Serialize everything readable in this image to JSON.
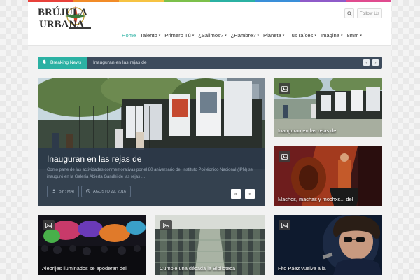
{
  "site": {
    "logo_alt": "Brújula Urbana",
    "logo_line1": "BRÚJULA",
    "logo_line2": "URBANA",
    "follow_label": "Follow Us"
  },
  "nav": {
    "items": [
      {
        "label": "Home",
        "active": true,
        "dropdown": false
      },
      {
        "label": "Talento",
        "active": false,
        "dropdown": true
      },
      {
        "label": "Primero Tú",
        "active": false,
        "dropdown": true
      },
      {
        "label": "¿Salimos?",
        "active": false,
        "dropdown": true
      },
      {
        "label": "¿Hambre?",
        "active": false,
        "dropdown": true
      },
      {
        "label": "Planeta",
        "active": false,
        "dropdown": true
      },
      {
        "label": "Tus raíces",
        "active": false,
        "dropdown": true
      },
      {
        "label": "Imagina",
        "active": false,
        "dropdown": true
      },
      {
        "label": "8mm",
        "active": false,
        "dropdown": true
      }
    ]
  },
  "ticker": {
    "label": "Breaking News",
    "text": "Inauguran en las rejas de"
  },
  "featured": {
    "title": "Inauguran en las rejas de",
    "excerpt": "Como parte de las actividades conmemorativas por el 80 aniversario del Instituto Politécnico Nacional (IPN) se inauguró en la Galería Abierta Gandhi de las rejas …",
    "author": "BY : MAI",
    "date": "AGOSTO 22, 2016",
    "prev": "«",
    "next": "»"
  },
  "side_cards": [
    {
      "caption": "Inauguran en las rejas de"
    },
    {
      "caption": "Machos, machas y mochxs... del"
    }
  ],
  "bottom_cards": [
    {
      "caption": "Alebrijes iluminados se apoderan del"
    },
    {
      "caption": "Cumple una década la Biblioteca"
    },
    {
      "caption": "Fito Páez vuelve a la"
    }
  ],
  "colors": {
    "accent": "#2bb1a3",
    "ticker_bg": "#3d4b5c",
    "top_stripe": [
      "#e8413b",
      "#f28c28",
      "#f6c343",
      "#7cc04b",
      "#2bb1a3",
      "#3a8fd9",
      "#8e5bc9",
      "#e04b8f"
    ]
  },
  "icons": {
    "search": "search-icon",
    "bell": "bell-icon",
    "camera": "camera-icon",
    "user": "user-icon",
    "clock": "clock-icon"
  }
}
